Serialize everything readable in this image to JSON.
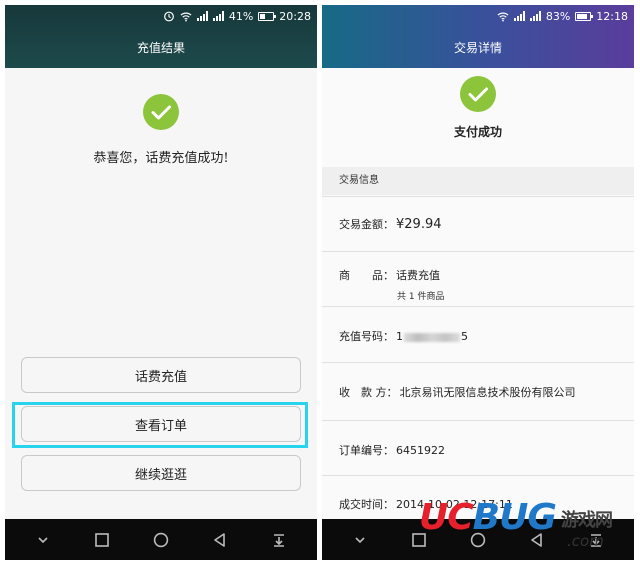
{
  "left_screen": {
    "status_bar": {
      "battery": "41%",
      "time": "20:28",
      "battery_level": 0.41
    },
    "title": "充值结果",
    "message": "恭喜您，话费充值成功!",
    "buttons": [
      "话费充值",
      "查看订单",
      "继续逛逛"
    ],
    "highlight_color": "#29d3ee"
  },
  "right_screen": {
    "status_bar": {
      "battery": "83%",
      "time": "12:18",
      "battery_level": 0.83
    },
    "title": "交易详情",
    "status": "支付成功",
    "section": "交易信息",
    "rows": [
      {
        "label": "交易金额：",
        "value": "¥29.94"
      },
      {
        "label": "商　　品：",
        "value": "话费充值",
        "sub": "共 1 件商品"
      },
      {
        "label": "充值号码：",
        "value_prefix": "1",
        "value_suffix": "5"
      },
      {
        "label": "收　款 方：",
        "value": "北京易讯无限信息技术股份有限公司"
      },
      {
        "label": "订单编号：",
        "value": "6451922"
      },
      {
        "label": "成交时间：",
        "value": "2014-10-02 12:17:11"
      }
    ]
  },
  "colors": {
    "success_green": "#8cc43c",
    "nav_bar": "#0b0b0b"
  },
  "icons": {
    "status_bar": [
      "alarm-icon",
      "wifi-icon",
      "signal-icon",
      "battery-icon"
    ],
    "nav_bar": [
      "chevron-down-icon",
      "recent-apps-icon",
      "home-icon",
      "back-icon",
      "notifications-icon"
    ],
    "content": [
      "checkmark-icon"
    ]
  },
  "watermark": {
    "logo_u": "U",
    "logo_c": "C",
    "logo_bug": "BUG",
    "site": "游戏网",
    "domain": ".com"
  }
}
